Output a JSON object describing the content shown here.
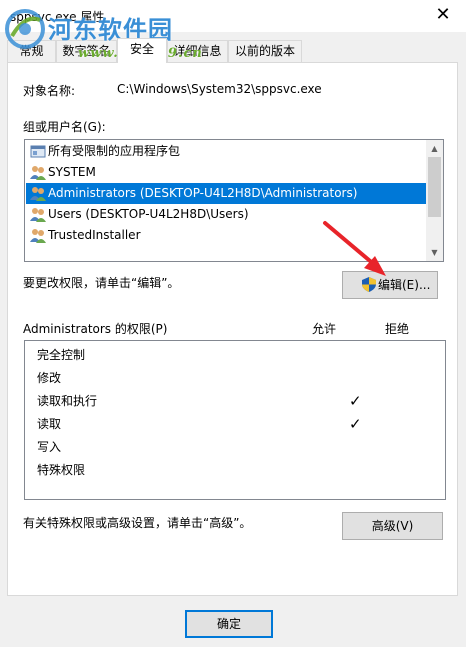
{
  "window": {
    "title": "sppsvc.exe 属性",
    "close_label": "✕"
  },
  "watermark": {
    "brand": "河东软件园",
    "url": "www.pc0359.cn"
  },
  "tabs": [
    {
      "label": "常规",
      "active": false
    },
    {
      "label": "数字签名",
      "active": false
    },
    {
      "label": "安全",
      "active": true
    },
    {
      "label": "详细信息",
      "active": false
    },
    {
      "label": "以前的版本",
      "active": false
    }
  ],
  "object": {
    "label": "对象名称:",
    "value": "C:\\Windows\\System32\\sppsvc.exe"
  },
  "groups": {
    "label": "组或用户名(G):",
    "items": [
      {
        "name": "所有受限制的应用程序包",
        "icon": "app-package-icon",
        "selected": false
      },
      {
        "name": "SYSTEM",
        "icon": "users-icon",
        "selected": false
      },
      {
        "name": "Administrators (DESKTOP-U4L2H8D\\Administrators)",
        "icon": "users-icon",
        "selected": true
      },
      {
        "name": "Users (DESKTOP-U4L2H8D\\Users)",
        "icon": "users-icon",
        "selected": false
      },
      {
        "name": "TrustedInstaller",
        "icon": "users-icon",
        "selected": false
      }
    ]
  },
  "edit_hint": "要更改权限，请单击“编辑”。",
  "edit_button": "编辑(E)...",
  "permissions": {
    "label": "Administrators 的权限(P)",
    "allow_header": "允许",
    "deny_header": "拒绝",
    "rows": [
      {
        "name": "完全控制",
        "allow": false,
        "deny": false
      },
      {
        "name": "修改",
        "allow": false,
        "deny": false
      },
      {
        "name": "读取和执行",
        "allow": true,
        "deny": false
      },
      {
        "name": "读取",
        "allow": true,
        "deny": false
      },
      {
        "name": "写入",
        "allow": false,
        "deny": false
      },
      {
        "name": "特殊权限",
        "allow": false,
        "deny": false
      }
    ],
    "check_glyph": "✓"
  },
  "advanced_hint": "有关特殊权限或高级设置，请单击“高级”。",
  "advanced_button": "高级(V)",
  "ok_button": "确定",
  "colors": {
    "selection": "#0078d7",
    "arrow": "#e8242a",
    "watermark_brand": "#3a8fd6",
    "watermark_url": "#6aab2e"
  }
}
